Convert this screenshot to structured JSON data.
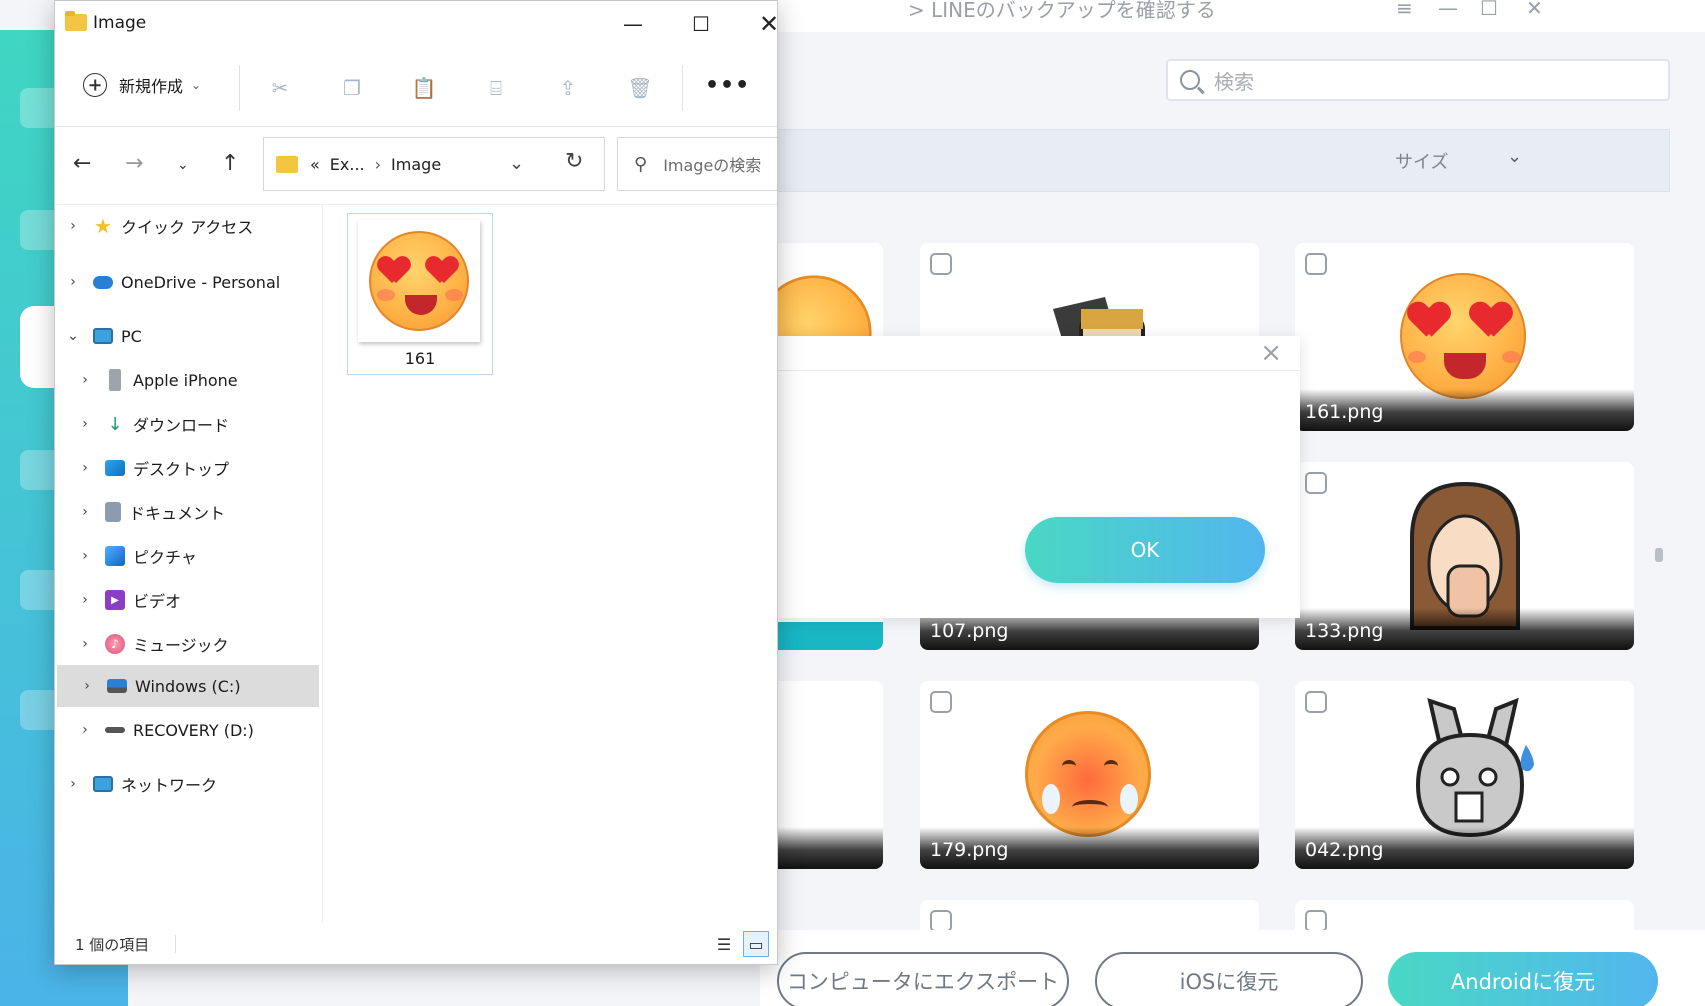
{
  "app": {
    "title": "LINEのバックアップを確認する",
    "win_controls": [
      "≡",
      "—",
      "☐",
      "✕"
    ],
    "search": {
      "placeholder": "検索"
    },
    "filter": {
      "size_label": "サイズ"
    },
    "cards": [
      {
        "name": ""
      },
      {
        "name": ""
      },
      {
        "name": "161.png"
      },
      {
        "name": "107.png"
      },
      {
        "name": "133.png"
      },
      {
        "name": "179.png"
      },
      {
        "name": "042.png"
      }
    ],
    "dialog": {
      "ok_label": "OK"
    },
    "buttons": {
      "export": "コンピュータにエクスポート",
      "ios": "iOSに復元",
      "android": "Androidに復元"
    },
    "colors": {
      "accent_start": "#49d8c4",
      "accent_end": "#52b6ee"
    }
  },
  "explorer": {
    "title": "Image",
    "toolbar": {
      "new_label": "新規作成"
    },
    "address": {
      "parent": "Ex...",
      "current": "Image",
      "overflow": "«"
    },
    "search": {
      "placeholder": "Imageの検索"
    },
    "nav": [
      {
        "label": "クイック アクセス",
        "icon": "star-icon"
      },
      {
        "label": "OneDrive - Personal",
        "icon": "cloud-icon"
      },
      {
        "label": "PC",
        "icon": "monitor-icon"
      },
      {
        "label": "Apple iPhone",
        "icon": "phone-icon"
      },
      {
        "label": "ダウンロード",
        "icon": "download-icon"
      },
      {
        "label": "デスクトップ",
        "icon": "desktop-icon"
      },
      {
        "label": "ドキュメント",
        "icon": "document-icon"
      },
      {
        "label": "ピクチャ",
        "icon": "picture-icon"
      },
      {
        "label": "ビデオ",
        "icon": "video-icon"
      },
      {
        "label": "ミュージック",
        "icon": "music-icon"
      },
      {
        "label": "Windows (C:)",
        "icon": "drive-icon"
      },
      {
        "label": "RECOVERY (D:)",
        "icon": "drive-icon"
      },
      {
        "label": "ネットワーク",
        "icon": "network-icon"
      }
    ],
    "files": [
      {
        "label": "161"
      }
    ],
    "status": {
      "count": "1 個の項目"
    }
  }
}
